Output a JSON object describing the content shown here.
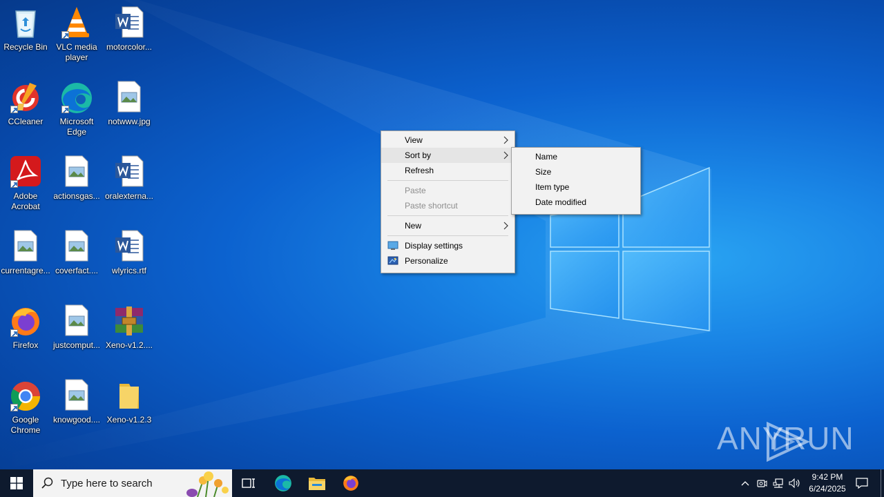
{
  "desktop_icons": [
    {
      "label": "Recycle Bin",
      "icon": "recycle-bin-icon"
    },
    {
      "label": "VLC media player",
      "icon": "vlc-icon"
    },
    {
      "label": "motorcolor...",
      "icon": "word-document-icon"
    },
    {
      "label": "CCleaner",
      "icon": "ccleaner-icon"
    },
    {
      "label": "Microsoft Edge",
      "icon": "edge-icon"
    },
    {
      "label": "notwww.jpg",
      "icon": "image-file-icon"
    },
    {
      "label": "Adobe Acrobat",
      "icon": "acrobat-icon"
    },
    {
      "label": "actionsgas...",
      "icon": "image-file-icon"
    },
    {
      "label": "oralexterna...",
      "icon": "word-document-icon"
    },
    {
      "label": "currentagre...",
      "icon": "image-file-icon"
    },
    {
      "label": "coverfact....",
      "icon": "image-file-icon"
    },
    {
      "label": "wlyrics.rtf",
      "icon": "word-document-icon"
    },
    {
      "label": "Firefox",
      "icon": "firefox-icon"
    },
    {
      "label": "justcomput...",
      "icon": "image-file-icon"
    },
    {
      "label": "Xeno-v1.2....",
      "icon": "winrar-icon"
    },
    {
      "label": "Google Chrome",
      "icon": "chrome-icon"
    },
    {
      "label": "knowgood....",
      "icon": "image-file-icon"
    },
    {
      "label": "Xeno-v1.2.3",
      "icon": "folder-icon"
    }
  ],
  "context_menu": {
    "view": "View",
    "sort_by": "Sort by",
    "refresh": "Refresh",
    "paste": "Paste",
    "paste_shortcut": "Paste shortcut",
    "new": "New",
    "display_settings": "Display settings",
    "personalize": "Personalize"
  },
  "sort_submenu": {
    "name": "Name",
    "size": "Size",
    "item_type": "Item type",
    "date_modified": "Date modified"
  },
  "taskbar": {
    "search_placeholder": "Type here to search",
    "time": "9:42 PM",
    "date": "6/24/2025"
  },
  "watermark": {
    "left": "ANY",
    "right": "RUN"
  },
  "colors": {
    "taskbar": "#0e1a2e",
    "menu_bg": "#f2f2f2",
    "menu_hover": "#e5e5e5",
    "wallpaper_accent": "#29a3f2"
  }
}
